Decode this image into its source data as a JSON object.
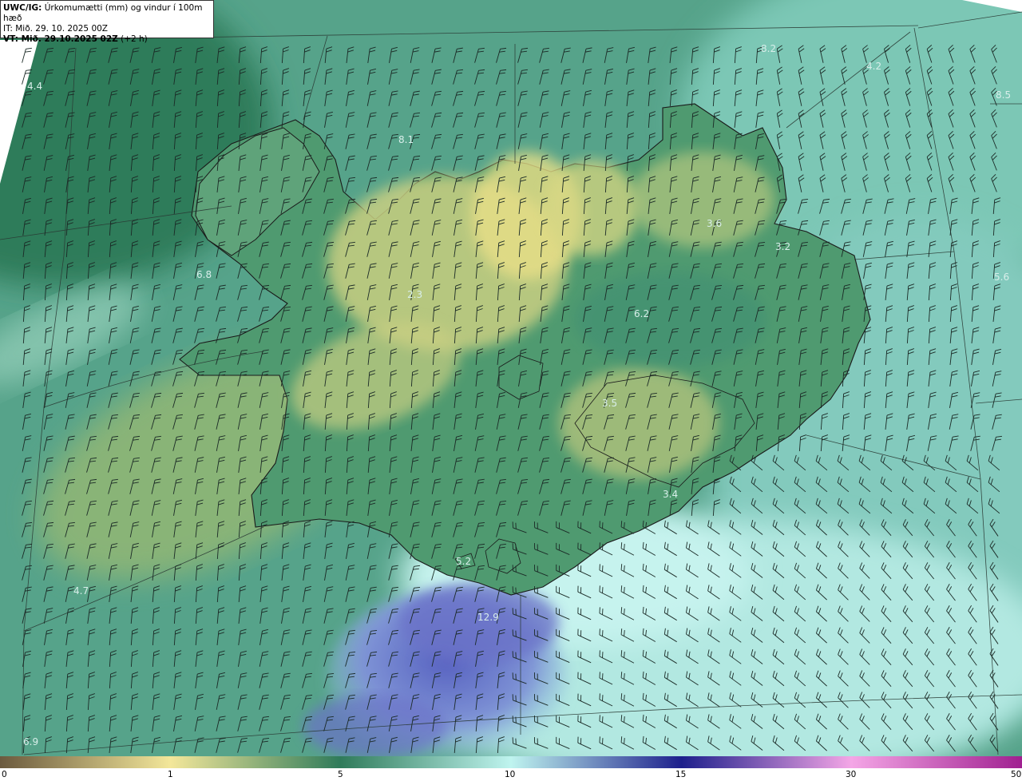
{
  "header": {
    "line1_bold": "UWC/IG:",
    "line1_rest": " Úrkomumætti (mm) og vindur í 100m hæð",
    "line2": "IT: Mið. 29. 10. 2025 00Z",
    "line3_bold": "VT: Mið. 29.10.2025 02Z",
    "line3_rest": " (+2 h)"
  },
  "labels": [
    "4.4",
    "8.2",
    "4.2",
    "8.5",
    "8.1",
    "3.6",
    "3.2",
    "6.8",
    "2.3",
    "6.2",
    "5.6",
    "3.5",
    "3.4",
    "5.2",
    "12.9",
    "4.7",
    "6.9"
  ],
  "colorbar": {
    "ticks": [
      "0",
      "1",
      "5",
      "10",
      "15",
      "30",
      "50"
    ],
    "stops": [
      "#6b5a3e",
      "#f3e79a",
      "#2f7b5a",
      "#bff4ef",
      "#1d1f8c",
      "#f4a6e6",
      "#a02090"
    ]
  },
  "colors": {
    "land_high": "#e9df87",
    "land_mid": "#5ea878",
    "sea_low": "#3f8f73",
    "sea_high": "#bff0ea",
    "heavy": "#6a72c8",
    "coast": "#1a1a1a"
  }
}
